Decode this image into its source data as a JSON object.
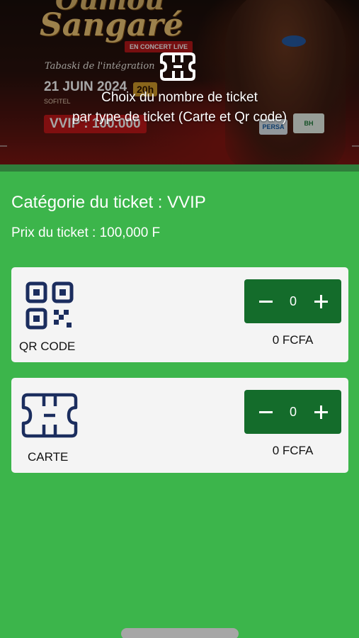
{
  "banner": {
    "artist_top": "Oumou",
    "artist_name": "Sangaré",
    "concert_badge": "EN CONCERT LIVE",
    "subtitle": "Tabaski de l'intégration",
    "date": "21 JUIN 2024",
    "time": "20h",
    "venue": "SOFITEL",
    "price_tag": "VVIP : 100.000",
    "sponsor_1": "PERSA",
    "sponsor_2": "BH",
    "overlay_icon": "ticket-icon",
    "overlay_text_line1": "Choix du nombre de ticket",
    "overlay_text_line2": "par type de ticket (Carte et Qr code)"
  },
  "category": {
    "title": "Catégorie du ticket : VVIP",
    "price": "Prix du ticket : 100,000 F"
  },
  "tickets": [
    {
      "icon": "qr-code-icon",
      "label": "QR CODE",
      "quantity": "0",
      "total": "0 FCFA"
    },
    {
      "icon": "ticket-card-icon",
      "label": "CARTE",
      "quantity": "0",
      "total": "0 FCFA"
    }
  ],
  "colors": {
    "background": "#3cb54b",
    "stepper": "#146c2b",
    "card": "#f4f4f4",
    "icon": "#1b2d5e"
  }
}
